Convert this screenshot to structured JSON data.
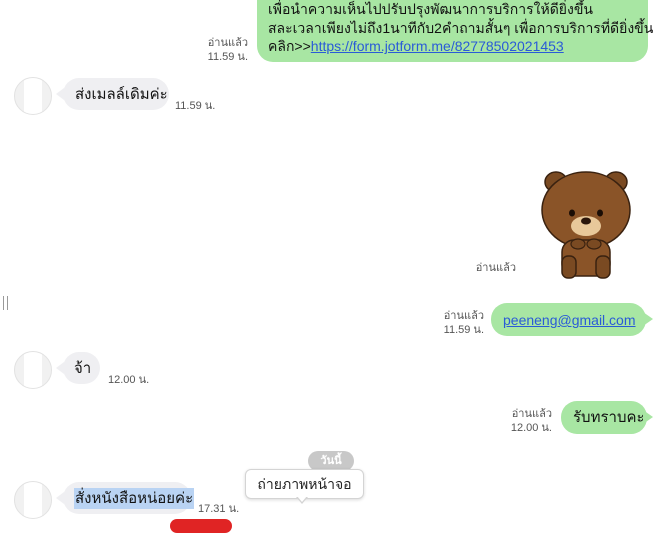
{
  "messages": {
    "survey": {
      "line1": "เพื่อนำความเห็นไปปรับปรุงพัฒนาการบริการให้ดียิ่งขึ้น",
      "line2": "สละเวลาเพียงไม่ถึง1นาทีกับ2คำถามสั้นๆ เพื่อการบริการที่ดียิ่งขึ้น",
      "prefix": "คลิก>>",
      "link": "https://form.jotform.me/82778502021453",
      "read": "อ่านแล้ว",
      "time": "11.59 น."
    },
    "send_email": {
      "text": "ส่งเมลล์เดิมค่ะ",
      "time": "11.59 น."
    },
    "sticker": {
      "read": "อ่านแล้ว"
    },
    "email": {
      "text": "peeneng@gmail.com",
      "read": "อ่านแล้ว",
      "time": "11.59 น."
    },
    "ja": {
      "text": "จ้า",
      "time": "12.00 น."
    },
    "ack": {
      "text": "รับทราบคะ",
      "read": "อ่านแล้ว",
      "time": "12.00 น."
    },
    "order": {
      "text": "สั่งหนังสือหน่อยค่ะ",
      "time": "17.31 น."
    }
  },
  "date_divider": "วันนี้",
  "screenshot_tooltip": "ถ่ายภาพหน้าจอ",
  "colors": {
    "outgoing": "#a8e6a3",
    "incoming": "#efeff2",
    "link": "#2a5bd7",
    "selection": "#b9d3f3"
  }
}
